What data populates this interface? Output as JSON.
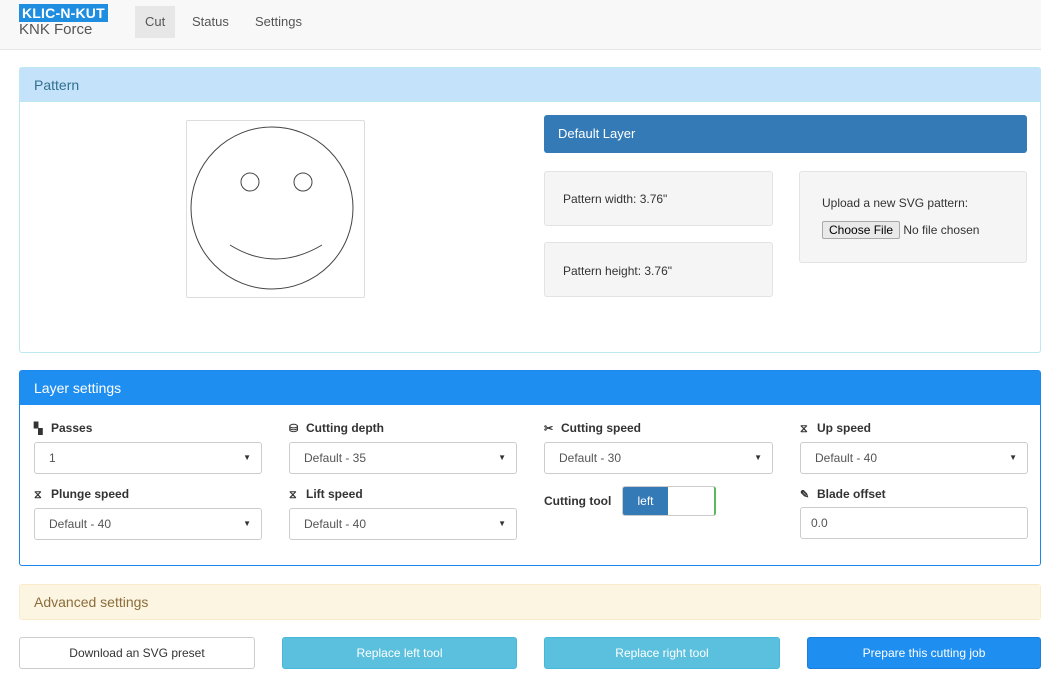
{
  "brand": {
    "logo_text": "KLIC-N-KUT",
    "subtitle": "KNK Force"
  },
  "nav": {
    "tabs": [
      {
        "label": "Cut",
        "active": true
      },
      {
        "label": "Status"
      },
      {
        "label": "Settings"
      }
    ]
  },
  "pattern_panel": {
    "title": "Pattern",
    "layer_button": "Default Layer",
    "width_text": "Pattern width: 3.76\"",
    "height_text": "Pattern height: 3.76\"",
    "upload_label": "Upload a new SVG pattern:",
    "choose_file": "Choose File",
    "no_file": "No file chosen"
  },
  "layer_settings": {
    "title": "Layer settings",
    "passes": {
      "label": "Passes",
      "value": "1",
      "icon": "copy-icon"
    },
    "cutting_depth": {
      "label": "Cutting depth",
      "value": "Default - 35",
      "icon": "hdd-icon"
    },
    "cutting_speed": {
      "label": "Cutting speed",
      "value": "Default - 30",
      "icon": "scissors-icon"
    },
    "up_speed": {
      "label": "Up speed",
      "value": "Default - 40",
      "icon": "hourglass-icon"
    },
    "plunge_speed": {
      "label": "Plunge speed",
      "value": "Default - 40",
      "icon": "hourglass-icon"
    },
    "lift_speed": {
      "label": "Lift speed",
      "value": "Default - 40",
      "icon": "hourglass-icon"
    },
    "cutting_tool": {
      "label": "Cutting tool",
      "value": "left"
    },
    "blade_offset": {
      "label": "Blade offset",
      "value": "0.0",
      "icon": "edit-icon"
    }
  },
  "advanced": {
    "title": "Advanced settings"
  },
  "actions": {
    "download": "Download an SVG preset",
    "replace_left": "Replace left tool",
    "replace_right": "Replace right tool",
    "prepare": "Prepare this cutting job"
  },
  "colors": {
    "primary": "#1e8ef0",
    "info": "#5bc0de",
    "layer": "#337ab7",
    "brand": "#1f8de0"
  }
}
